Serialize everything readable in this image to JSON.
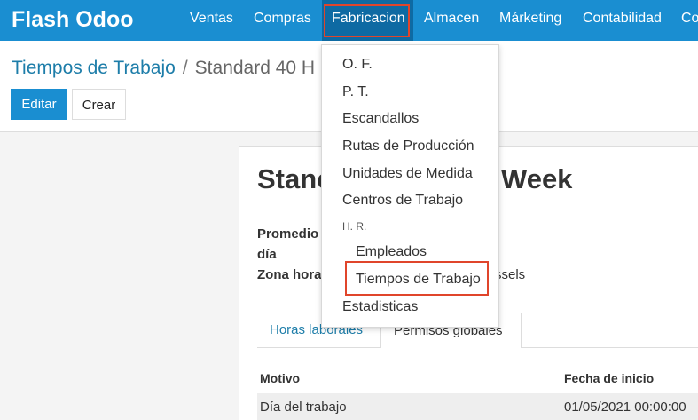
{
  "app": {
    "brand": "Flash Odoo",
    "nav": [
      "Ventas",
      "Compras",
      "Fabricacion",
      "Almacen",
      "Márketing",
      "Contabilidad",
      "Co"
    ]
  },
  "breadcrumb": {
    "parent": "Tiempos de Trabajo",
    "separator": "/",
    "current": "Standard 40 H"
  },
  "toolbar": {
    "edit_label": "Editar",
    "create_label": "Crear"
  },
  "record": {
    "title_start": "Stanc",
    "title_end": "Week",
    "label_average": "Promedio",
    "label_day": "día",
    "label_timezone": "Zona hora",
    "timezone_value": "ssels"
  },
  "tabs": {
    "hours": "Horas laborales",
    "leaves": "Permisos globales"
  },
  "table": {
    "headers": {
      "reason": "Motivo",
      "start": "Fecha de inicio"
    },
    "rows": [
      {
        "reason": "Día del trabajo",
        "start": "01/05/2021 00:00:00"
      }
    ]
  },
  "menu": {
    "items": [
      "O. F.",
      "P. T.",
      "Escandallos",
      "Rutas de Producción",
      "Unidades de Medida",
      "Centros de Trabajo"
    ],
    "section_header": "H. R.",
    "sub_items": [
      "Empleados",
      "Tiempos de Trabajo"
    ],
    "last_item": "Estadisticas"
  },
  "colors": {
    "topbar": "#1a8ed1",
    "highlight": "#e0452b",
    "link": "#1d7da9"
  }
}
